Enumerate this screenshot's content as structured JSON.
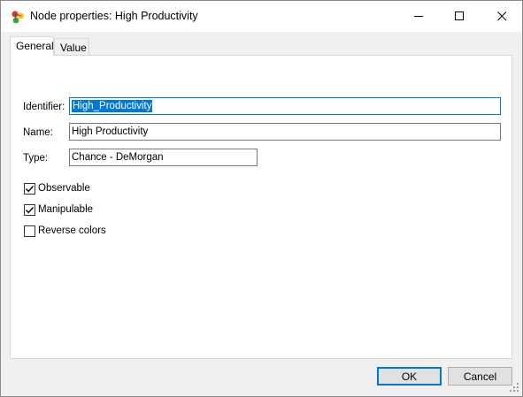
{
  "window": {
    "title": "Node properties: High Productivity",
    "icon": "app-network-icon",
    "controls": {
      "minimize": "minimize-icon",
      "maximize": "maximize-icon",
      "close": "close-icon"
    }
  },
  "tabs": [
    {
      "label": "General",
      "active": true
    },
    {
      "label": "Value",
      "active": false
    }
  ],
  "general": {
    "identifier": {
      "label": "Identifier:",
      "value": "High_Productivity"
    },
    "name": {
      "label": "Name:",
      "value": "High Productivity"
    },
    "type": {
      "label": "Type:",
      "value": "Chance - DeMorgan"
    },
    "checkboxes": [
      {
        "label": "Observable",
        "checked": true
      },
      {
        "label": "Manipulable",
        "checked": true
      },
      {
        "label": "Reverse colors",
        "checked": false
      }
    ]
  },
  "buttons": {
    "ok": "OK",
    "cancel": "Cancel"
  },
  "colors": {
    "accent": "#0078d7",
    "panel": "#ffffff",
    "chrome": "#f0f0f0"
  }
}
